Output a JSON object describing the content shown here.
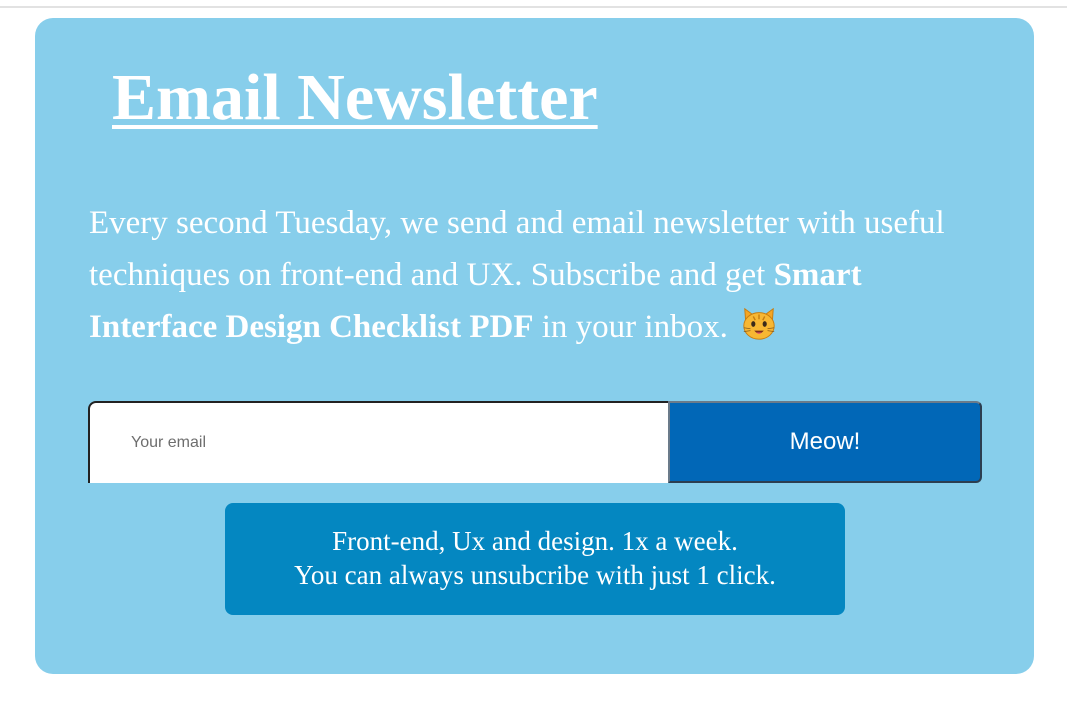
{
  "newsletter": {
    "title": "Email Newsletter",
    "description_part1": "Every second Tuesday, we send and email newsletter with useful techniques on front-end and UX. Subscribe and get ",
    "description_bold": "Smart Interface Design Checklist PDF",
    "description_part2": " in your inbox.",
    "emoji_icon": "cat-face-icon"
  },
  "form": {
    "email_placeholder": "Your email",
    "email_value": "",
    "submit_label": "Meow!"
  },
  "note": {
    "line1": "Front-end, Ux and design. 1x a week.",
    "line2": "You can always unsubcribe with just 1 click."
  },
  "colors": {
    "card_background": "#87ceeb",
    "button_background": "#0167b7",
    "note_background": "#0487c1",
    "text": "#ffffff"
  }
}
